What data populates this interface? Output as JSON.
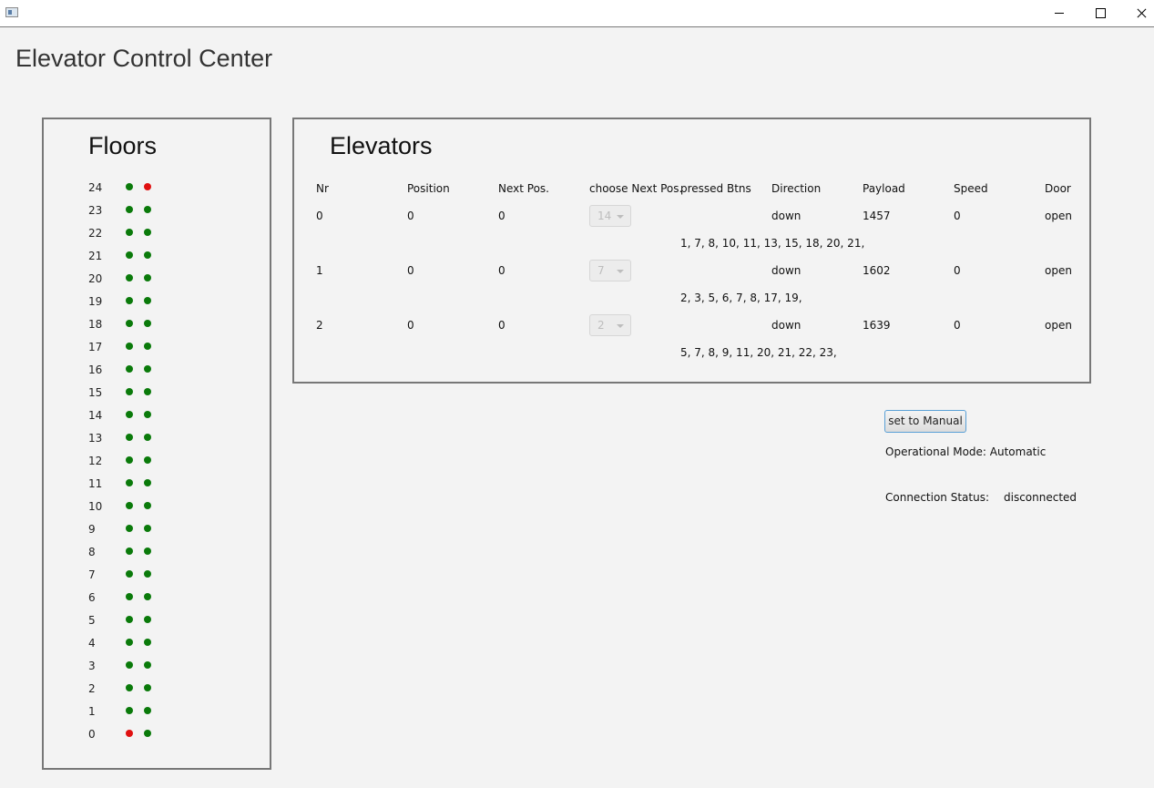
{
  "window": {
    "controls": [
      "minimize-icon",
      "maximize-icon",
      "close-icon"
    ]
  },
  "app_title": "Elevator Control Center",
  "floors": {
    "title": "Floors",
    "colors": {
      "green": "#0a7a0a",
      "red": "#e01010"
    },
    "rows": [
      {
        "floor": "24",
        "up": "green",
        "down": "red"
      },
      {
        "floor": "23",
        "up": "green",
        "down": "green"
      },
      {
        "floor": "22",
        "up": "green",
        "down": "green"
      },
      {
        "floor": "21",
        "up": "green",
        "down": "green"
      },
      {
        "floor": "20",
        "up": "green",
        "down": "green"
      },
      {
        "floor": "19",
        "up": "green",
        "down": "green"
      },
      {
        "floor": "18",
        "up": "green",
        "down": "green"
      },
      {
        "floor": "17",
        "up": "green",
        "down": "green"
      },
      {
        "floor": "16",
        "up": "green",
        "down": "green"
      },
      {
        "floor": "15",
        "up": "green",
        "down": "green"
      },
      {
        "floor": "14",
        "up": "green",
        "down": "green"
      },
      {
        "floor": "13",
        "up": "green",
        "down": "green"
      },
      {
        "floor": "12",
        "up": "green",
        "down": "green"
      },
      {
        "floor": "11",
        "up": "green",
        "down": "green"
      },
      {
        "floor": "10",
        "up": "green",
        "down": "green"
      },
      {
        "floor": "9",
        "up": "green",
        "down": "green"
      },
      {
        "floor": "8",
        "up": "green",
        "down": "green"
      },
      {
        "floor": "7",
        "up": "green",
        "down": "green"
      },
      {
        "floor": "6",
        "up": "green",
        "down": "green"
      },
      {
        "floor": "5",
        "up": "green",
        "down": "green"
      },
      {
        "floor": "4",
        "up": "green",
        "down": "green"
      },
      {
        "floor": "3",
        "up": "green",
        "down": "green"
      },
      {
        "floor": "2",
        "up": "green",
        "down": "green"
      },
      {
        "floor": "1",
        "up": "green",
        "down": "green"
      },
      {
        "floor": "0",
        "up": "red",
        "down": "green"
      }
    ]
  },
  "elevators": {
    "title": "Elevators",
    "headers": [
      "Nr",
      "Position",
      "Next Pos.",
      "choose Next Pos.",
      "pressed Btns",
      "Direction",
      "Payload",
      "Speed",
      "Door"
    ],
    "rows": [
      {
        "nr": "0",
        "position": "0",
        "next_pos": "0",
        "choose": "14",
        "pressed": "1, 7, 8, 10, 11, 13, 15, 18, 20, 21,",
        "direction": "down",
        "payload": "1457",
        "speed": "0",
        "door": "open"
      },
      {
        "nr": "1",
        "position": "0",
        "next_pos": "0",
        "choose": "7",
        "pressed": "2, 3, 5, 6, 7, 8, 17, 19,",
        "direction": "down",
        "payload": "1602",
        "speed": "0",
        "door": "open"
      },
      {
        "nr": "2",
        "position": "0",
        "next_pos": "0",
        "choose": "2",
        "pressed": "5, 7, 8, 9, 11, 20, 21, 22, 23,",
        "direction": "down",
        "payload": "1639",
        "speed": "0",
        "door": "open"
      }
    ]
  },
  "controls": {
    "manual_button": "set to Manual",
    "mode_text": "Operational Mode: Automatic",
    "connection_label": "Connection Status:",
    "connection_value": "disconnected"
  }
}
